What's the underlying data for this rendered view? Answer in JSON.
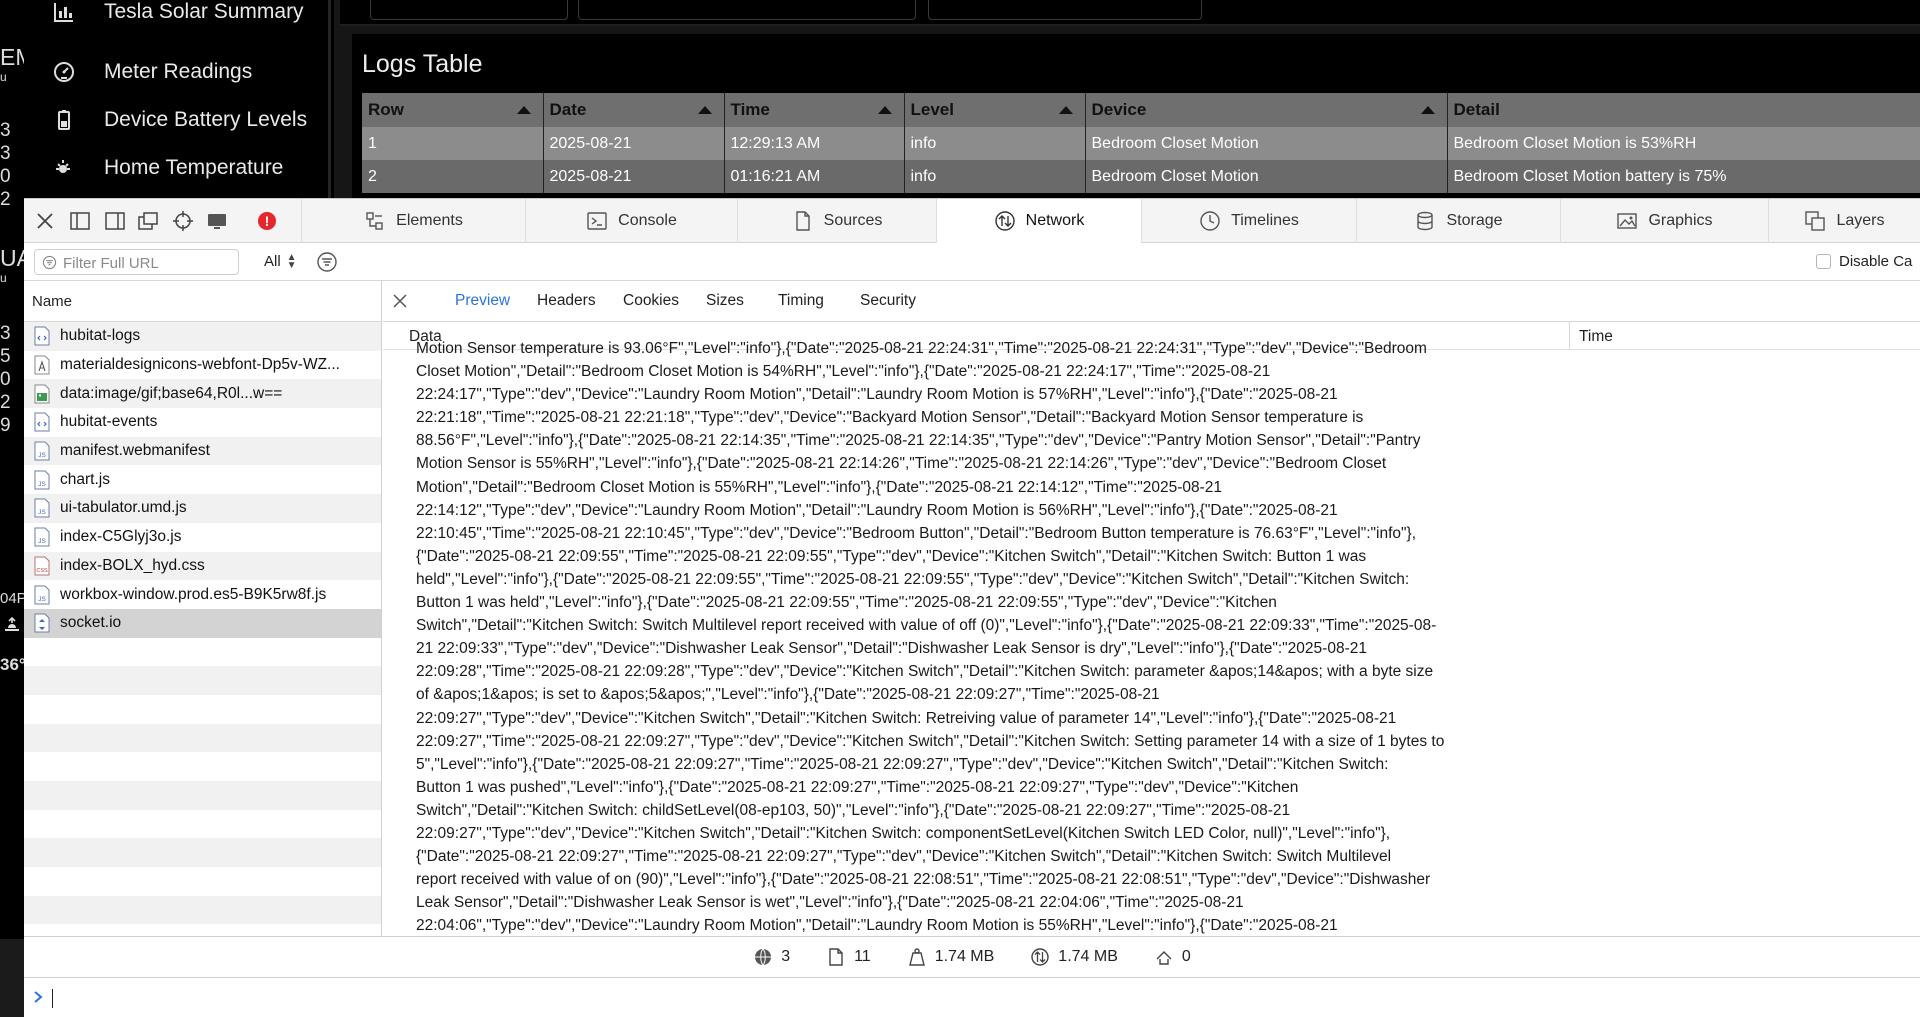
{
  "sidebar": {
    "items": [
      {
        "label": "Tesla Solar Summary",
        "icon": "bar-chart-icon"
      },
      {
        "label": "Meter Readings",
        "icon": "gauge-icon"
      },
      {
        "label": "Device Battery Levels",
        "icon": "battery-icon"
      },
      {
        "label": "Home Temperature",
        "icon": "sun-thermometer-icon"
      }
    ]
  },
  "left_strip": [
    "EM",
    "u",
    "3",
    "3",
    "0",
    "2",
    "UA",
    "u",
    "3",
    "5",
    "0",
    "2",
    "9",
    "04P",
    "36°"
  ],
  "logs": {
    "title": "Logs Table",
    "columns": [
      "Row",
      "Date",
      "Time",
      "Level",
      "Device",
      "Detail"
    ],
    "rows": [
      [
        "1",
        "2025-08-21",
        "12:29:13 AM",
        "info",
        "Bedroom Closet Motion",
        "Bedroom Closet Motion is 53%RH"
      ],
      [
        "2",
        "2025-08-21",
        "01:16:21 AM",
        "info",
        "Bedroom Closet Motion",
        "Bedroom Closet Motion battery is 75%"
      ]
    ]
  },
  "devtools": {
    "tabs": [
      {
        "label": "Elements",
        "icon": "elements-icon"
      },
      {
        "label": "Console",
        "icon": "console-icon"
      },
      {
        "label": "Sources",
        "icon": "sources-icon"
      },
      {
        "label": "Network",
        "icon": "network-icon",
        "active": true
      },
      {
        "label": "Timelines",
        "icon": "timelines-icon"
      },
      {
        "label": "Storage",
        "icon": "storage-icon"
      },
      {
        "label": "Graphics",
        "icon": "graphics-icon"
      },
      {
        "label": "Layers",
        "icon": "layers-icon"
      }
    ],
    "error_badge": "!",
    "filter": {
      "placeholder": "Filter Full URL",
      "value": ""
    },
    "type_select": "All",
    "disable_cache": "Disable Ca",
    "name_header": "Name",
    "resources": [
      {
        "name": "hubitat-logs",
        "type": "xhr"
      },
      {
        "name": "materialdesignicons-webfont-Dp5v-WZ...",
        "type": "font"
      },
      {
        "name": "data:image/gif;base64,R0l...w==",
        "type": "image"
      },
      {
        "name": "hubitat-events",
        "type": "xhr"
      },
      {
        "name": "manifest.webmanifest",
        "type": "js"
      },
      {
        "name": "chart.js",
        "type": "js"
      },
      {
        "name": "ui-tabulator.umd.js",
        "type": "js"
      },
      {
        "name": "index-C5Glyj3o.js",
        "type": "js"
      },
      {
        "name": "index-BOLX_hyd.css",
        "type": "css"
      },
      {
        "name": "workbox-window.prod.es5-B9K5rw8f.js",
        "type": "js"
      },
      {
        "name": "socket.io",
        "type": "socket",
        "selected": true
      }
    ],
    "detail_tabs": [
      "Preview",
      "Headers",
      "Cookies",
      "Sizes",
      "Timing",
      "Security"
    ],
    "data_header": "Data",
    "time_header": "Time",
    "data_lines": [
      "Motion Sensor temperature is 93.06°F\",\"Level\":\"info\"},{\"Date\":\"2025-08-21 22:24:31\",\"Time\":\"2025-08-21 22:24:31\",\"Type\":\"dev\",\"Device\":\"Bedroom",
      "Closet Motion\",\"Detail\":\"Bedroom Closet Motion is 54%RH\",\"Level\":\"info\"},{\"Date\":\"2025-08-21 22:24:17\",\"Time\":\"2025-08-21",
      "22:24:17\",\"Type\":\"dev\",\"Device\":\"Laundry Room Motion\",\"Detail\":\"Laundry Room Motion is 57%RH\",\"Level\":\"info\"},{\"Date\":\"2025-08-21",
      "22:21:18\",\"Time\":\"2025-08-21 22:21:18\",\"Type\":\"dev\",\"Device\":\"Backyard Motion Sensor\",\"Detail\":\"Backyard Motion Sensor temperature is",
      "88.56°F\",\"Level\":\"info\"},{\"Date\":\"2025-08-21 22:14:35\",\"Time\":\"2025-08-21 22:14:35\",\"Type\":\"dev\",\"Device\":\"Pantry Motion Sensor\",\"Detail\":\"Pantry",
      "Motion Sensor is 55%RH\",\"Level\":\"info\"},{\"Date\":\"2025-08-21 22:14:26\",\"Time\":\"2025-08-21 22:14:26\",\"Type\":\"dev\",\"Device\":\"Bedroom Closet",
      "Motion\",\"Detail\":\"Bedroom Closet Motion is 55%RH\",\"Level\":\"info\"},{\"Date\":\"2025-08-21 22:14:12\",\"Time\":\"2025-08-21",
      "22:14:12\",\"Type\":\"dev\",\"Device\":\"Laundry Room Motion\",\"Detail\":\"Laundry Room Motion is 56%RH\",\"Level\":\"info\"},{\"Date\":\"2025-08-21",
      "22:10:45\",\"Time\":\"2025-08-21 22:10:45\",\"Type\":\"dev\",\"Device\":\"Bedroom Button\",\"Detail\":\"Bedroom Button temperature is 76.63°F\",\"Level\":\"info\"},",
      "{\"Date\":\"2025-08-21 22:09:55\",\"Time\":\"2025-08-21 22:09:55\",\"Type\":\"dev\",\"Device\":\"Kitchen Switch\",\"Detail\":\"Kitchen Switch: Button 1 was",
      "held\",\"Level\":\"info\"},{\"Date\":\"2025-08-21 22:09:55\",\"Time\":\"2025-08-21 22:09:55\",\"Type\":\"dev\",\"Device\":\"Kitchen Switch\",\"Detail\":\"Kitchen Switch:",
      "Button 1 was held\",\"Level\":\"info\"},{\"Date\":\"2025-08-21 22:09:55\",\"Time\":\"2025-08-21 22:09:55\",\"Type\":\"dev\",\"Device\":\"Kitchen",
      "Switch\",\"Detail\":\"Kitchen Switch: Switch Multilevel report received with value of off (0)\",\"Level\":\"info\"},{\"Date\":\"2025-08-21 22:09:33\",\"Time\":\"2025-08-",
      "21 22:09:33\",\"Type\":\"dev\",\"Device\":\"Dishwasher Leak Sensor\",\"Detail\":\"Dishwasher Leak Sensor is dry\",\"Level\":\"info\"},{\"Date\":\"2025-08-21",
      "22:09:28\",\"Time\":\"2025-08-21 22:09:28\",\"Type\":\"dev\",\"Device\":\"Kitchen Switch\",\"Detail\":\"Kitchen Switch: parameter &apos;14&apos; with a byte size",
      "of &apos;1&apos; is set to &apos;5&apos;\",\"Level\":\"info\"},{\"Date\":\"2025-08-21 22:09:27\",\"Time\":\"2025-08-21",
      "22:09:27\",\"Type\":\"dev\",\"Device\":\"Kitchen Switch\",\"Detail\":\"Kitchen Switch: Retreiving value of parameter 14\",\"Level\":\"info\"},{\"Date\":\"2025-08-21",
      "22:09:27\",\"Time\":\"2025-08-21 22:09:27\",\"Type\":\"dev\",\"Device\":\"Kitchen Switch\",\"Detail\":\"Kitchen Switch: Setting parameter 14 with a size of 1 bytes to",
      "5\",\"Level\":\"info\"},{\"Date\":\"2025-08-21 22:09:27\",\"Time\":\"2025-08-21 22:09:27\",\"Type\":\"dev\",\"Device\":\"Kitchen Switch\",\"Detail\":\"Kitchen Switch:",
      "Button 1 was pushed\",\"Level\":\"info\"},{\"Date\":\"2025-08-21 22:09:27\",\"Time\":\"2025-08-21 22:09:27\",\"Type\":\"dev\",\"Device\":\"Kitchen",
      "Switch\",\"Detail\":\"Kitchen Switch: childSetLevel(08-ep103, 50)\",\"Level\":\"info\"},{\"Date\":\"2025-08-21 22:09:27\",\"Time\":\"2025-08-21",
      "22:09:27\",\"Type\":\"dev\",\"Device\":\"Kitchen Switch\",\"Detail\":\"Kitchen Switch: componentSetLevel(Kitchen Switch LED Color, null)\",\"Level\":\"info\"},",
      "{\"Date\":\"2025-08-21 22:09:27\",\"Time\":\"2025-08-21 22:09:27\",\"Type\":\"dev\",\"Device\":\"Kitchen Switch\",\"Detail\":\"Kitchen Switch: Switch Multilevel",
      "report received with value of on (90)\",\"Level\":\"info\"},{\"Date\":\"2025-08-21 22:08:51\",\"Time\":\"2025-08-21 22:08:51\",\"Type\":\"dev\",\"Device\":\"Dishwasher",
      "Leak Sensor\",\"Detail\":\"Dishwasher Leak Sensor is wet\",\"Level\":\"info\"},{\"Date\":\"2025-08-21 22:04:06\",\"Time\":\"2025-08-21",
      "22:04:06\",\"Type\":\"dev\",\"Device\":\"Laundry Room Motion\",\"Detail\":\"Laundry Room Motion is 55%RH\",\"Level\":\"info\"},{\"Date\":\"2025-08-21"
    ],
    "status": {
      "domains": "3",
      "resources": "11",
      "transferred": "1.74 MB",
      "size": "1.74 MB",
      "redirects": "0"
    }
  },
  "colors": {
    "accent": "#2a73d9",
    "error": "#e5262a",
    "table_header": "#6f6f6f"
  }
}
